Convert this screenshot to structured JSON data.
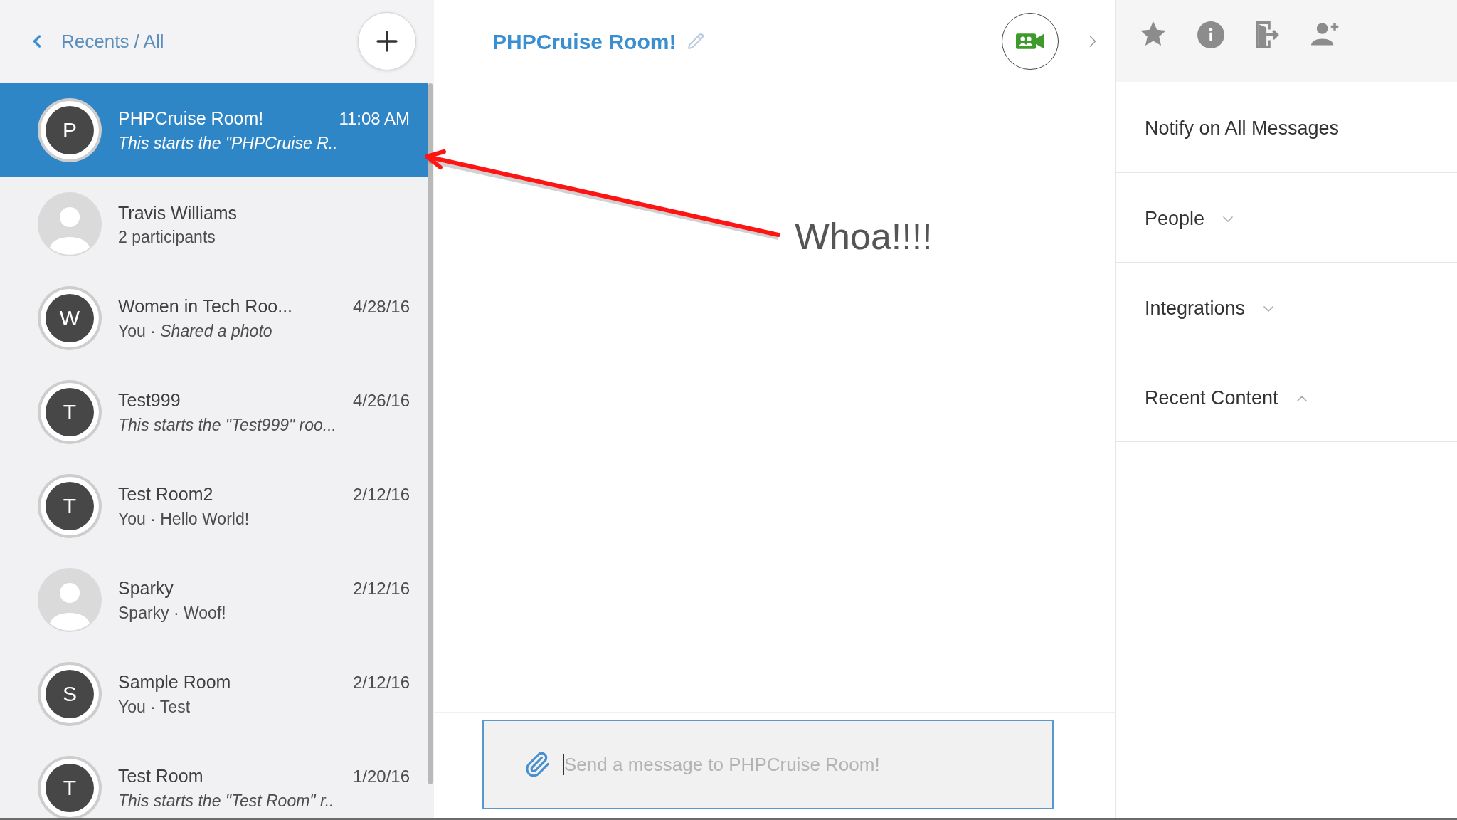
{
  "sidebar": {
    "breadcrumb": "Recents / All",
    "conversations": [
      {
        "name": "PHPCruise Room!",
        "timestamp": "11:08 AM",
        "preview": "This starts the \"PHPCruise R..",
        "preview_italic": true,
        "selected": true,
        "avatar": {
          "kind": "letter",
          "letter": "P"
        }
      },
      {
        "name": "Travis Williams",
        "preview": "2 participants",
        "preview_italic": false,
        "selected": false,
        "avatar": {
          "kind": "silhouette"
        }
      },
      {
        "name": "Women in Tech Roo...",
        "timestamp": "4/28/16",
        "preview": "You · *Shared a photo*",
        "preview_italic": false,
        "selected": false,
        "avatar": {
          "kind": "letter",
          "letter": "W"
        }
      },
      {
        "name": "Test999",
        "timestamp": "4/26/16",
        "preview": "This starts the \"Test999\" roo...",
        "preview_italic": true,
        "selected": false,
        "avatar": {
          "kind": "letter",
          "letter": "T"
        }
      },
      {
        "name": "Test Room2",
        "timestamp": "2/12/16",
        "preview": "You · Hello World!",
        "preview_italic": false,
        "selected": false,
        "avatar": {
          "kind": "letter",
          "letter": "T"
        }
      },
      {
        "name": "Sparky",
        "timestamp": "2/12/16",
        "preview": "Sparky · Woof!",
        "preview_italic": false,
        "selected": false,
        "avatar": {
          "kind": "silhouette"
        }
      },
      {
        "name": "Sample Room",
        "timestamp": "2/12/16",
        "preview": "You · Test",
        "preview_italic": false,
        "selected": false,
        "avatar": {
          "kind": "letter",
          "letter": "S"
        }
      },
      {
        "name": "Test Room",
        "timestamp": "1/20/16",
        "preview": "This starts the \"Test Room\" r..",
        "preview_italic": true,
        "selected": false,
        "avatar": {
          "kind": "letter",
          "letter": "T"
        }
      }
    ]
  },
  "chat": {
    "title": "PHPCruise Room!",
    "composer": {
      "placeholder": "Send a message to PHPCruise Room!"
    }
  },
  "details": {
    "sections": [
      {
        "kind": "setting",
        "label": "Notify on All Messages"
      },
      {
        "kind": "collapsible",
        "label": "People",
        "expanded": false
      },
      {
        "kind": "collapsible",
        "label": "Integrations",
        "expanded": false
      },
      {
        "kind": "collapsible",
        "label": "Recent Content",
        "expanded": true
      }
    ]
  },
  "annotation": {
    "text": "Whoa!!!!"
  }
}
